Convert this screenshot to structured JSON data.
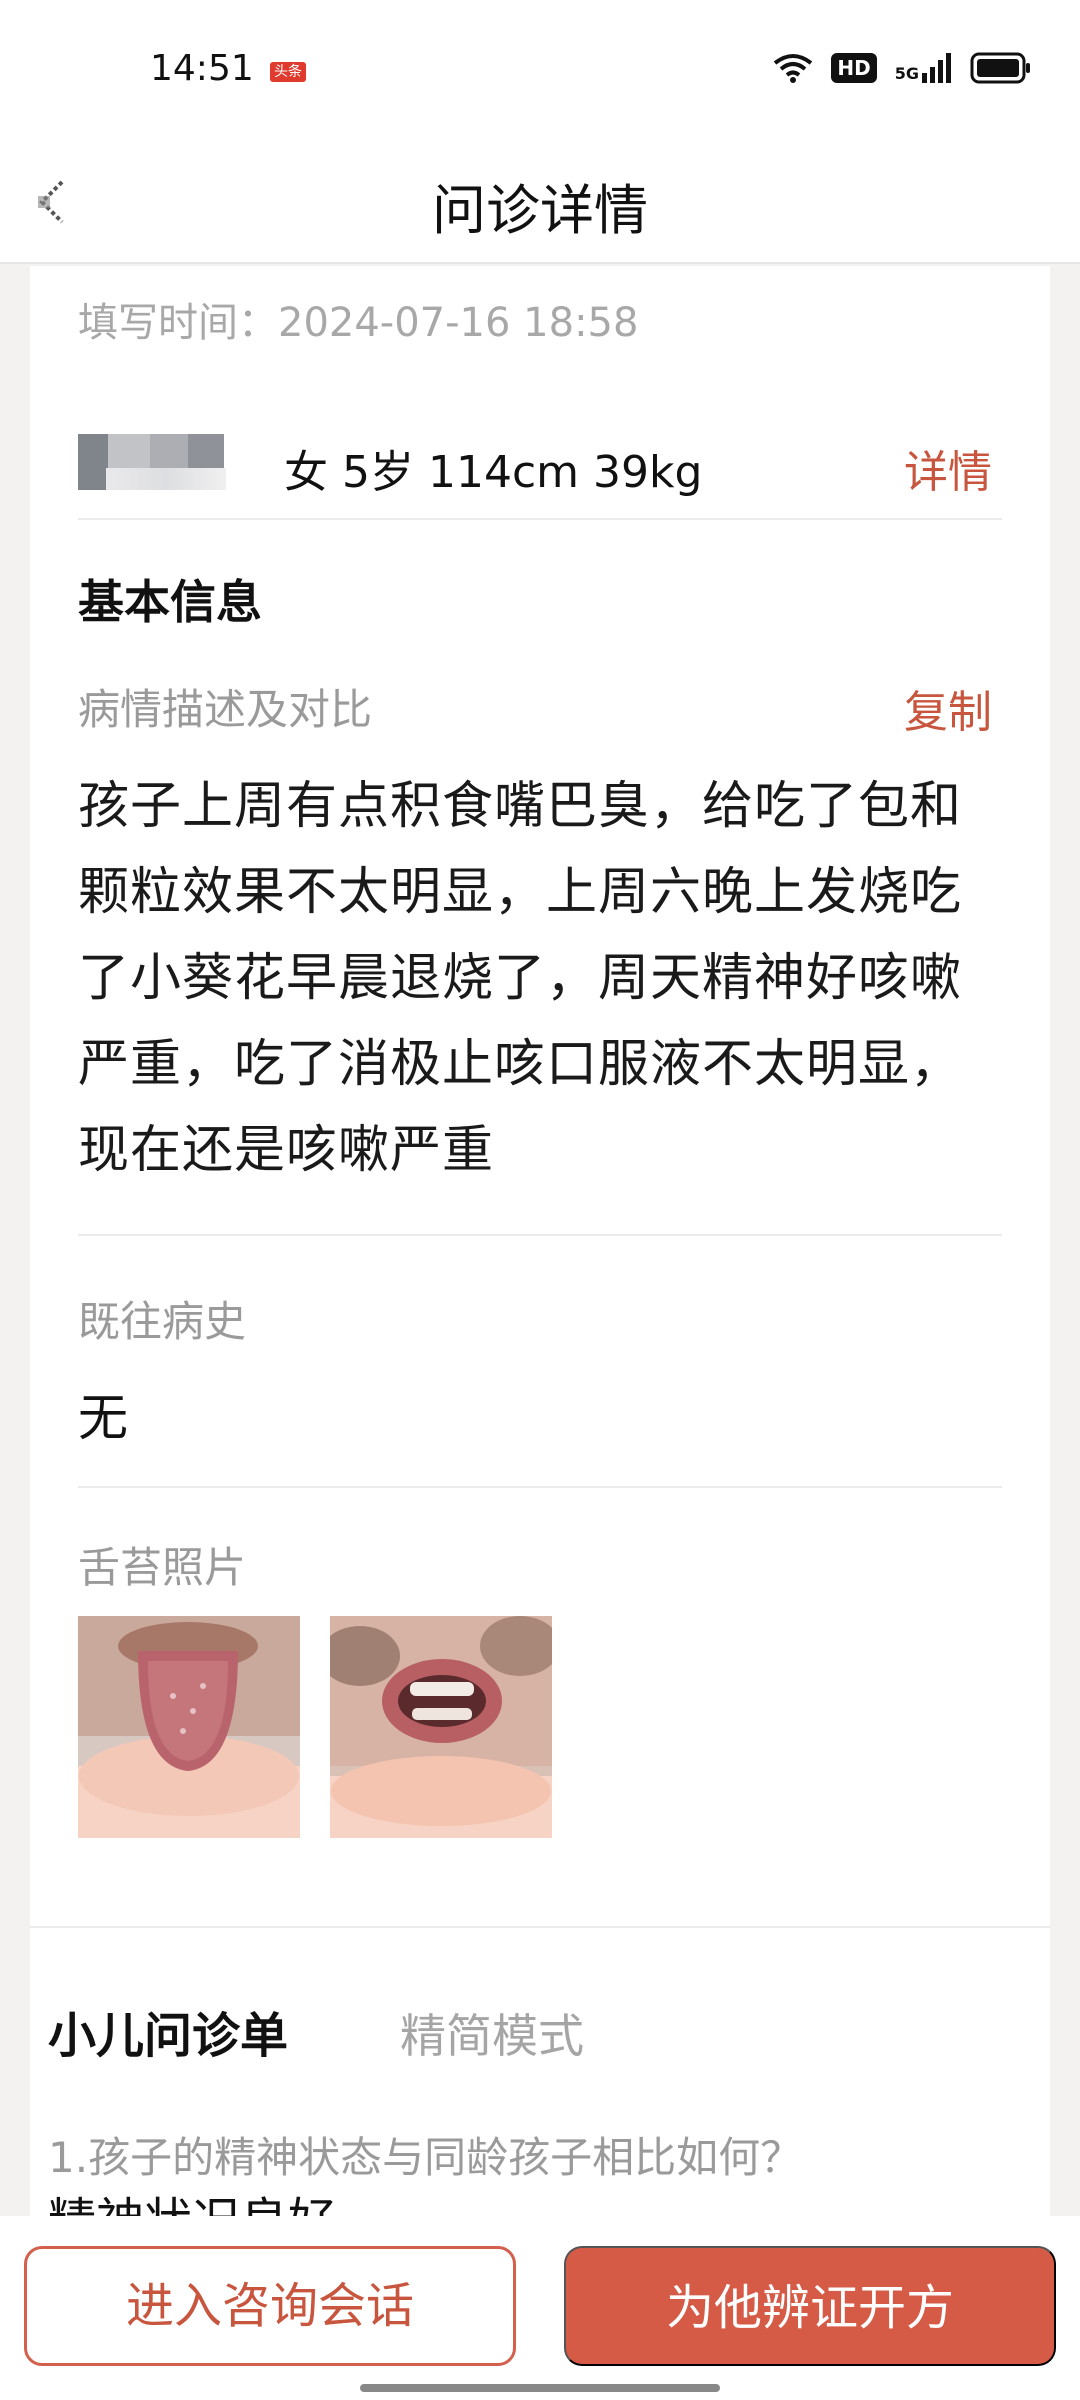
{
  "status_bar": {
    "time": "14:51",
    "app_badge": "头条",
    "hd_label": "HD",
    "network": "5G"
  },
  "nav": {
    "title": "问诊详情"
  },
  "record": {
    "fill_time": "填写时间：2024-07-16 18:58",
    "patient_info": "女 5岁 114cm 39kg",
    "detail_link": "详情"
  },
  "basic_info": {
    "title": "基本信息",
    "desc_label": "病情描述及对比",
    "copy_label": "复制",
    "desc_lines": [
      "孩子上周有点积食嘴巴臭，给吃了包和",
      "颗粒效果不太明显，上周六晚上发烧吃",
      "了小葵花早晨退烧了，周天精神好咳嗽",
      "严重，吃了消极止咳口服液不太明显，",
      "现在还是咳嗽严重"
    ],
    "history_label": "既往病史",
    "history_value": "无",
    "photos_label": "舌苔照片"
  },
  "form": {
    "title": "小儿问诊单",
    "mode_label": "精简模式",
    "question_1": "1.孩子的精神状态与同龄孩子相比如何？",
    "answer_1": "精神状况良好"
  },
  "actions": {
    "enter_chat": "进入咨询会话",
    "prescribe": "为他辨证开方"
  },
  "colors": {
    "accent": "#c8553d",
    "primary_button": "#d65b47"
  }
}
